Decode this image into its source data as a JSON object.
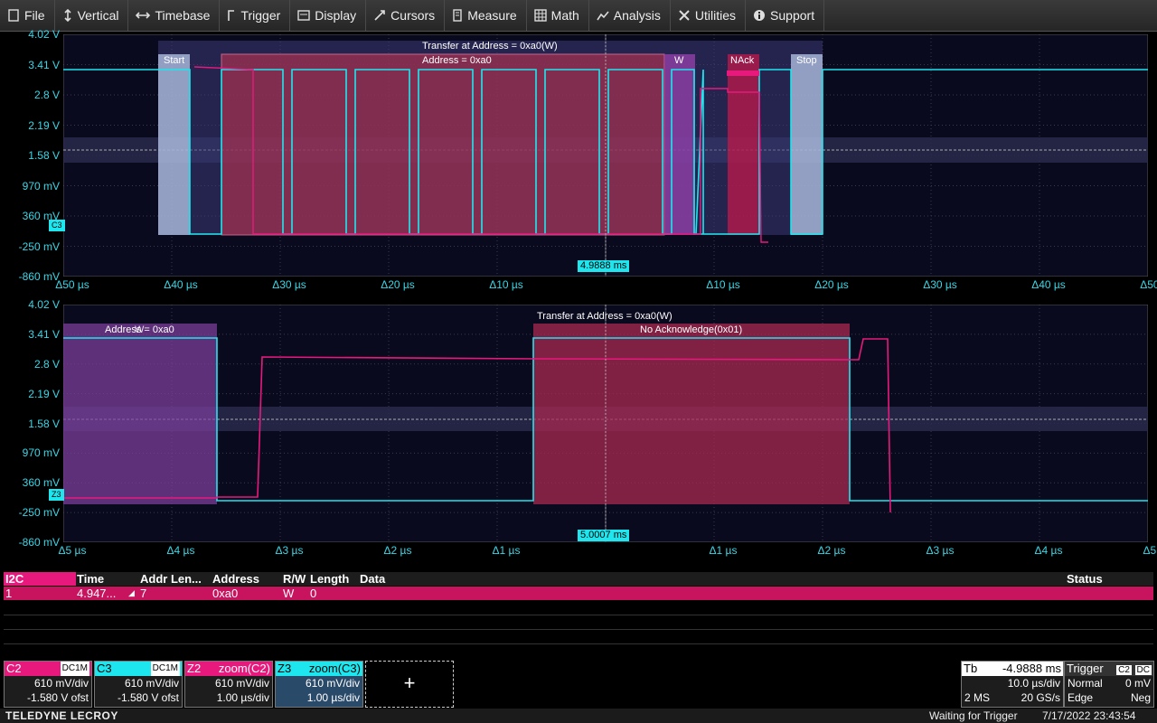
{
  "menu": [
    {
      "label": "File",
      "icon": "file-icon"
    },
    {
      "label": "Vertical",
      "icon": "vertical-arrows-icon"
    },
    {
      "label": "Timebase",
      "icon": "horizontal-arrows-icon"
    },
    {
      "label": "Trigger",
      "icon": "trigger-icon"
    },
    {
      "label": "Display",
      "icon": "display-icon"
    },
    {
      "label": "Cursors",
      "icon": "cursors-icon"
    },
    {
      "label": "Measure",
      "icon": "measure-icon"
    },
    {
      "label": "Math",
      "icon": "math-icon"
    },
    {
      "label": "Analysis",
      "icon": "analysis-icon"
    },
    {
      "label": "Utilities",
      "icon": "utilities-icon"
    },
    {
      "label": "Support",
      "icon": "support-icon"
    }
  ],
  "ylabels": [
    "4.02 V",
    "3.41 V",
    "2.8 V",
    "2.19 V",
    "1.58 V",
    "970 mV",
    "360 mV",
    "-250 mV",
    "-860 mV"
  ],
  "top": {
    "xlabels": [
      "Δ50 µs",
      "Δ40 µs",
      "Δ30 µs",
      "Δ20 µs",
      "Δ10 µs",
      "Δ10 µs",
      "Δ20 µs",
      "Δ30 µs",
      "Δ40 µs",
      "Δ50 µs"
    ],
    "transfer_label": "Transfer at Address = 0xa0(W)",
    "start_label": "Start",
    "address_label": "Address = 0xa0",
    "w_label": "W",
    "nack_label": "NAck",
    "stop_label": "Stop",
    "cursor_time": "4.9888 ms",
    "channel_marker": "C3"
  },
  "bottom": {
    "xlabels": [
      "Δ5 µs",
      "Δ4 µs",
      "Δ3 µs",
      "Δ2 µs",
      "Δ1 µs",
      "Δ1 µs",
      "Δ2 µs",
      "Δ3 µs",
      "Δ4 µs",
      "Δ5 µs"
    ],
    "transfer_label": "Transfer at Address = 0xa0(W)",
    "address_label": "Address = 0xa0",
    "overlay_w": "W",
    "nack_label": "No Acknowledge(0x01)",
    "cursor_time": "5.0007 ms",
    "channel_marker": "Z3"
  },
  "table": {
    "decoder": "I2C",
    "columns": [
      "Time",
      "Addr Len...",
      "Address",
      "R/W",
      "Length",
      "Data",
      "Status"
    ],
    "row": {
      "index": "1",
      "time": "4.947...",
      "addr_len": "7",
      "address": "0xa0",
      "rw": "W",
      "length": "0",
      "data": "",
      "status": ""
    }
  },
  "traces": [
    {
      "name": "C2",
      "coupling": "DC1M",
      "vdiv": "610 mV/div",
      "offset": "-1.580 V ofst",
      "color": "#e8197d"
    },
    {
      "name": "C3",
      "coupling": "DC1M",
      "vdiv": "610 mV/div",
      "offset": "-1.580 V ofst",
      "color": "#1ee6ee"
    },
    {
      "name": "Z2",
      "coupling": "zoom(C2)",
      "vdiv": "610 mV/div",
      "offset": "1.00 µs/div",
      "color": "#e8197d"
    },
    {
      "name": "Z3",
      "coupling": "zoom(C3)",
      "vdiv": "610 mV/div",
      "offset": "1.00 µs/div",
      "color": "#1ee6ee"
    }
  ],
  "add_button": "+",
  "timebase": {
    "label": "Tb",
    "delay": "-4.9888 ms",
    "tdiv": "10.0 µs/div",
    "samples": "2 MS",
    "rate": "20 GS/s"
  },
  "trigger": {
    "label": "Trigger",
    "src": "C2",
    "coup": "DC",
    "mode": "Normal",
    "level": "0 mV",
    "type": "Edge",
    "slope": "Neg"
  },
  "brand": "TELEDYNE LECROY",
  "status": "Waiting for Trigger",
  "datetime": "7/17/2022 23:43:54"
}
